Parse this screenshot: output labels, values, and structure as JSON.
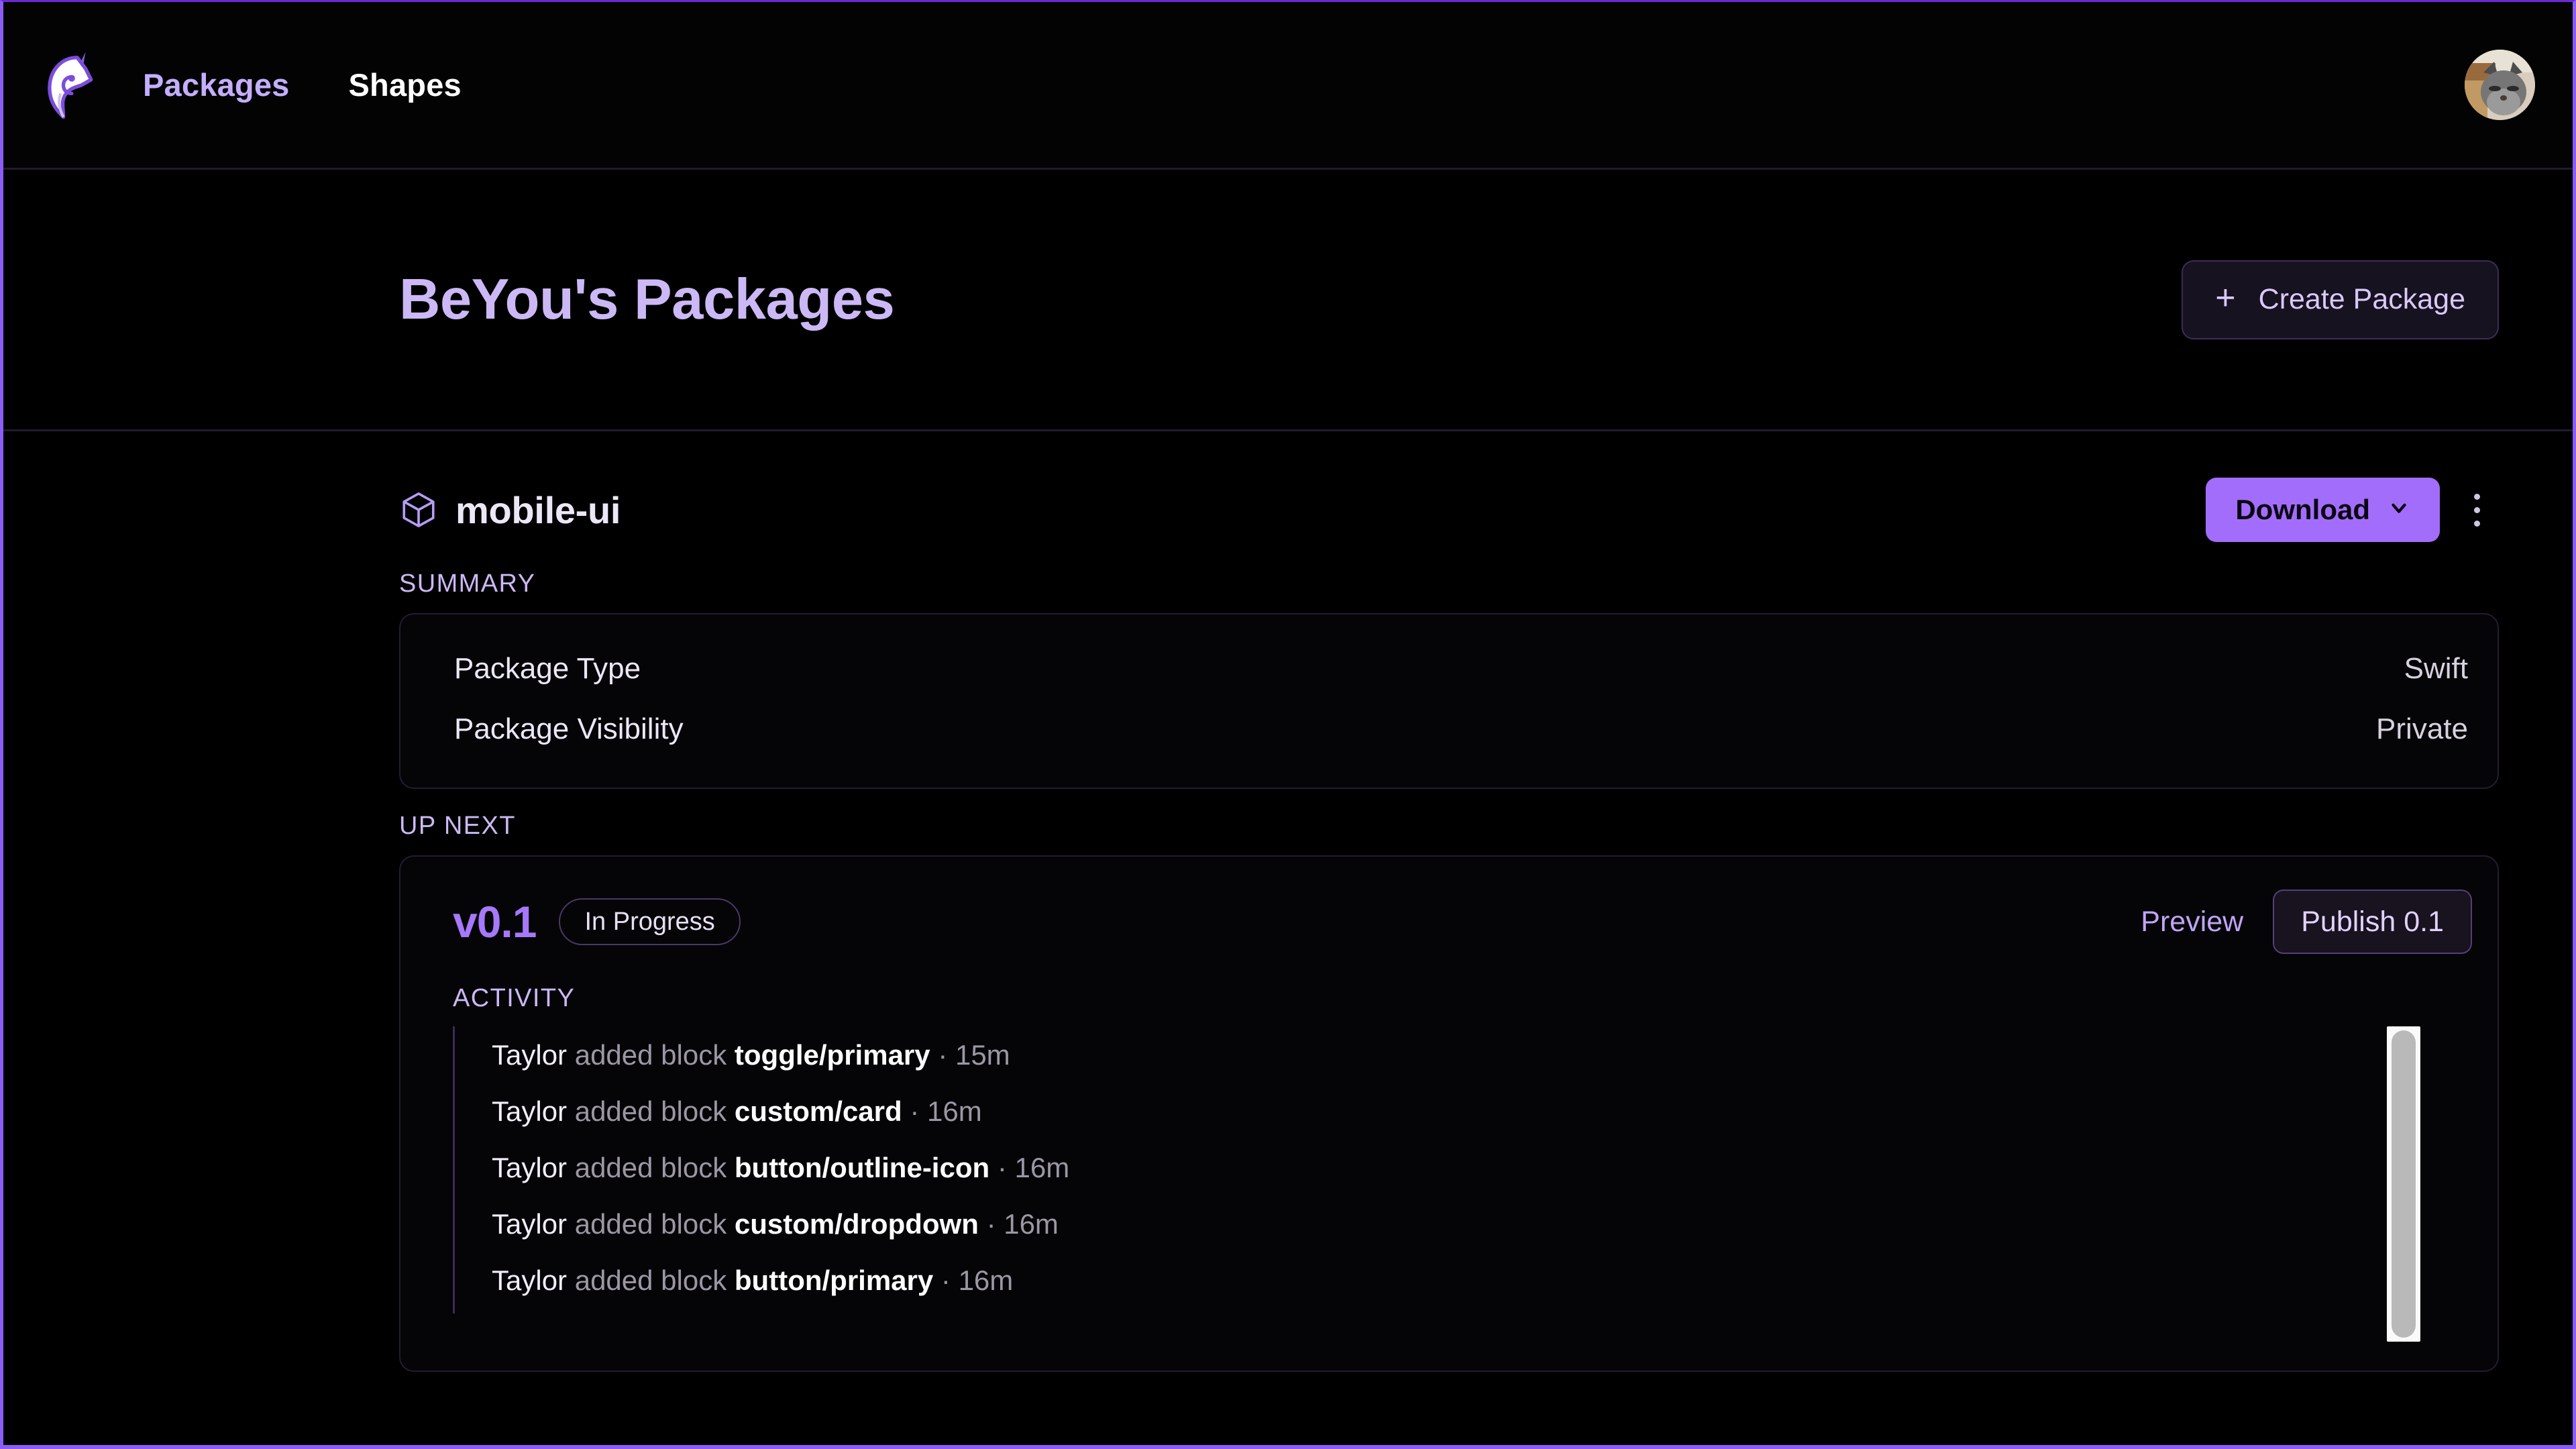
{
  "navbar": {
    "logo_icon": "unicorn-logo",
    "links": [
      {
        "label": "Packages",
        "active": true
      },
      {
        "label": "Shapes",
        "active": false
      }
    ],
    "avatar_icon": "user-avatar-cat-photo"
  },
  "page_header": {
    "title": "BeYou's Packages",
    "create_button": {
      "label": "Create Package",
      "icon": "plus-icon"
    }
  },
  "package": {
    "icon": "cube-icon",
    "name": "mobile-ui",
    "download_button": {
      "label": "Download",
      "icon": "chevron-down-icon"
    },
    "more_menu_icon": "kebab-menu-icon"
  },
  "summary": {
    "label": "SUMMARY",
    "rows": [
      {
        "key": "Package Type",
        "value": "Swift"
      },
      {
        "key": "Package Visibility",
        "value": "Private"
      }
    ]
  },
  "up_next": {
    "label": "UP NEXT",
    "version": "v0.1",
    "status_badge": "In Progress",
    "preview_link": "Preview",
    "publish_button": "Publish 0.1",
    "activity_label": "ACTIVITY",
    "activity": [
      {
        "actor": "Taylor",
        "verb": "added block",
        "block": "toggle/primary",
        "time": "· 15m"
      },
      {
        "actor": "Taylor",
        "verb": "added block",
        "block": "custom/card",
        "time": "· 16m"
      },
      {
        "actor": "Taylor",
        "verb": "added block",
        "block": "button/outline-icon",
        "time": "· 16m"
      },
      {
        "actor": "Taylor",
        "verb": "added block",
        "block": "custom/dropdown",
        "time": "· 16m"
      },
      {
        "actor": "Taylor",
        "verb": "added block",
        "block": "button/primary",
        "time": "· 16m"
      }
    ]
  },
  "colors": {
    "accent_purple": "#a26dfa",
    "accent_light": "#cbb8f5",
    "background": "#000000",
    "border_purple": "#8b5cf6",
    "card_border": "#241c31"
  }
}
